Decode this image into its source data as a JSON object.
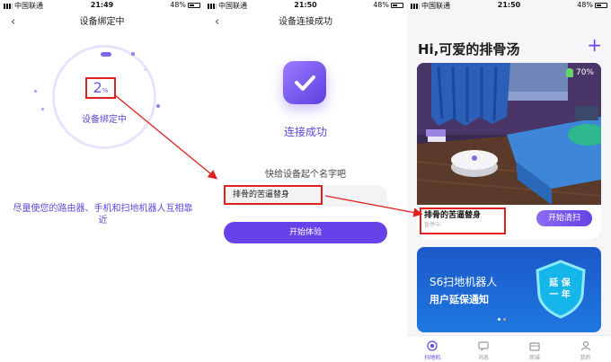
{
  "colors": {
    "accent": "#6642E8",
    "annotation": "#E02020",
    "banner": "#1E6ADB"
  },
  "screen1": {
    "status": {
      "carrier": "中国联通",
      "time": "21:49",
      "battery": "48%"
    },
    "title": "设备绑定中",
    "progress_value": "2",
    "progress_unit": "%",
    "progress_label": "设备绑定中",
    "hint": "尽量使您的路由器、手机和扫地机器人互相靠近"
  },
  "screen2": {
    "status": {
      "carrier": "中国联通",
      "time": "21:50",
      "battery": "48%"
    },
    "title": "设备连接成功",
    "success_text": "连接成功",
    "name_prompt": "快给设备起个名字吧",
    "name_value": "排骨的苦逼替身",
    "start_button": "开始体验"
  },
  "screen3": {
    "status": {
      "carrier": "中国联通",
      "time": "21:50",
      "battery": "48%"
    },
    "greeting": "Hi,可爱的排骨汤",
    "device": {
      "name": "排骨的苦逼替身",
      "status": "暂停中",
      "battery": "70%",
      "clean_button": "开始清扫"
    },
    "banner": {
      "line1": "S6扫地机器人",
      "line2": "用户延保通知",
      "badge_line1": "延 保",
      "badge_line2": "一 年"
    },
    "tabs": [
      {
        "label": "扫地机",
        "icon": "robot-icon",
        "active": true
      },
      {
        "label": "消息",
        "icon": "message-icon",
        "active": false
      },
      {
        "label": "商城",
        "icon": "store-icon",
        "active": false
      },
      {
        "label": "我的",
        "icon": "profile-icon",
        "active": false
      }
    ]
  }
}
